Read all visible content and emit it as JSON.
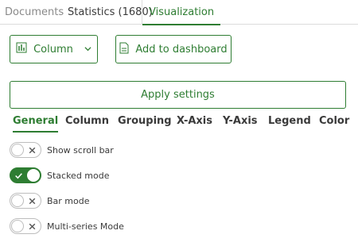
{
  "tabs": [
    {
      "label": "Documents"
    },
    {
      "label": "Statistics (1680)"
    },
    {
      "label": "Visualization"
    }
  ],
  "toolbar": {
    "column_label": "Column",
    "column_icon": "chart-column-icon",
    "dashboard_label": "Add to dashboard",
    "dashboard_icon": "document-icon",
    "apply_label": "Apply settings"
  },
  "subtabs": [
    {
      "label": "General"
    },
    {
      "label": "Column"
    },
    {
      "label": "Grouping"
    },
    {
      "label": "X-Axis"
    },
    {
      "label": "Y-Axis"
    },
    {
      "label": "Legend"
    },
    {
      "label": "Color"
    }
  ],
  "toggles": [
    {
      "label": "Show scroll bar",
      "on": false
    },
    {
      "label": "Stacked mode",
      "on": true
    },
    {
      "label": "Bar mode",
      "on": false
    },
    {
      "label": "Multi-series Mode",
      "on": false
    }
  ],
  "colors": {
    "accent": "#2e7d32",
    "border": "#bdbdbd"
  }
}
